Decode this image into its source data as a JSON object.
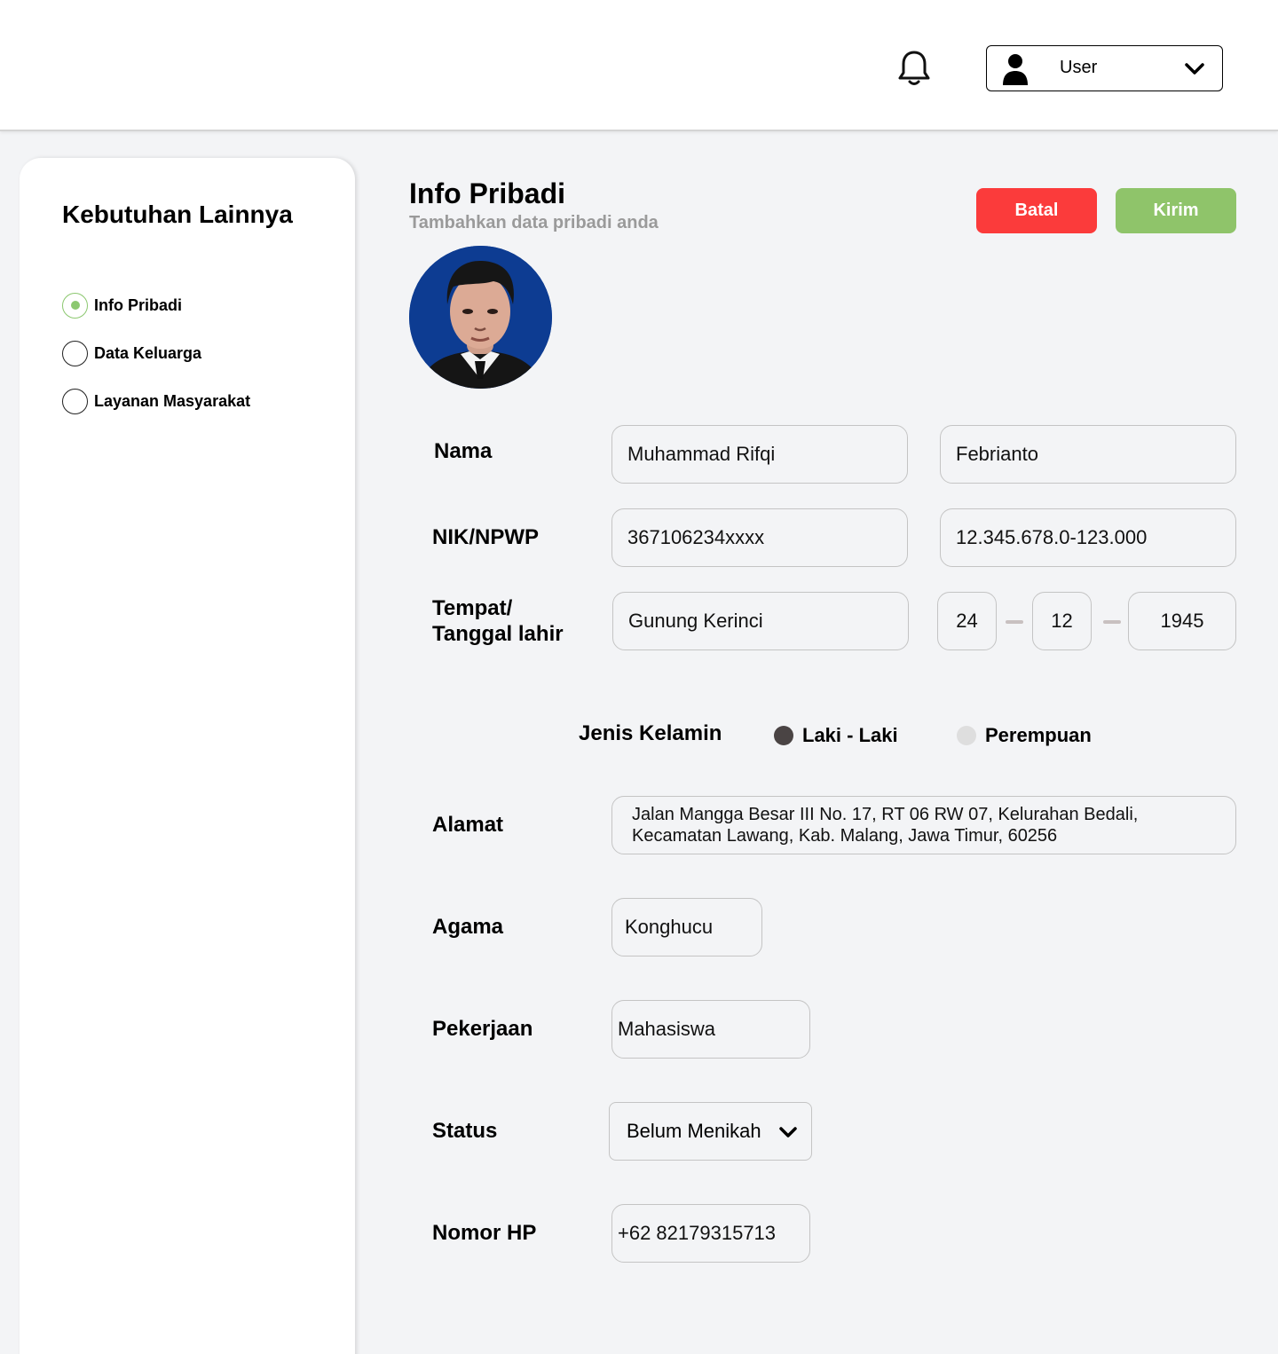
{
  "header": {
    "user_label": "User",
    "icons": {
      "notification": "bell-icon",
      "user": "user-icon",
      "dropdown": "chevron-down-icon"
    }
  },
  "sidebar": {
    "title": "Kebutuhan Lainnya",
    "items": [
      {
        "label": "Info Pribadi",
        "active": true
      },
      {
        "label": "Data Keluarga",
        "active": false
      },
      {
        "label": "Layanan Masyarakat",
        "active": false
      }
    ]
  },
  "main": {
    "title": "Info Pribadi",
    "subtitle": "Tambahkan data pribadi anda",
    "buttons": {
      "cancel": "Batal",
      "submit": "Kirim"
    }
  },
  "form": {
    "nama": {
      "label": "Nama",
      "first": "Muhammad Rifqi",
      "last": "Febrianto"
    },
    "nik": {
      "label": "NIK/NPWP",
      "nik": "367106234xxxx",
      "npwp": "12.345.678.0-123.000"
    },
    "ttl": {
      "label_line1": "Tempat/",
      "label_line2": "Tanggal lahir",
      "place": "Gunung Kerinci",
      "day": "24",
      "month": "12",
      "year": "1945"
    },
    "gender": {
      "label": "Jenis Kelamin",
      "options": [
        {
          "label": "Laki - Laki",
          "selected": true
        },
        {
          "label": "Perempuan",
          "selected": false
        }
      ]
    },
    "alamat": {
      "label": "Alamat",
      "line1": "Jalan Mangga Besar III No. 17, RT 06 RW 07, Kelurahan Bedali,",
      "line2": "Kecamatan Lawang, Kab. Malang, Jawa Timur, 60256"
    },
    "agama": {
      "label": "Agama",
      "value": "Konghucu"
    },
    "pekerjaan": {
      "label": "Pekerjaan",
      "value": "Mahasiswa"
    },
    "status": {
      "label": "Status",
      "value": "Belum Menikah"
    },
    "hp": {
      "label": "Nomor HP",
      "value": "+62 82179315713"
    }
  },
  "colors": {
    "cancel_button": "#fb3b3b",
    "submit_button": "#8fc46a",
    "active_radio": "#8cc870",
    "subtitle_text": "#9a9a9a",
    "background": "#f3f4f6"
  }
}
